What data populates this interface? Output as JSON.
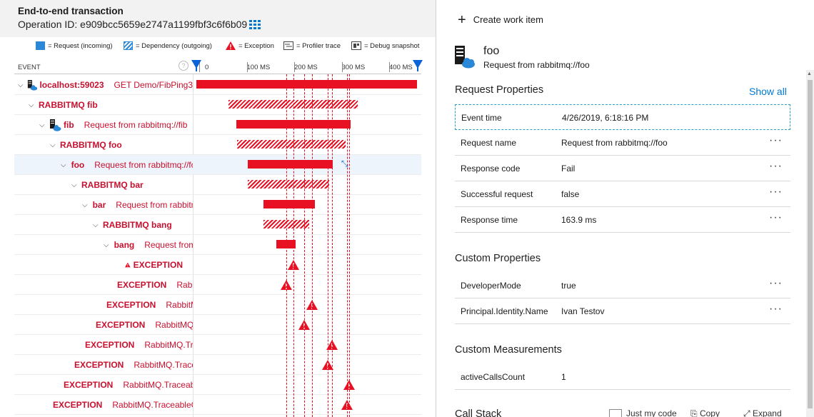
{
  "header": {
    "title": "End-to-end transaction",
    "operation": "Operation ID: e909bcc5659e2747a1199fbf3c6f6b09"
  },
  "legend": {
    "request": "= Request (incoming)",
    "dependency": "= Dependency (outgoing)",
    "exception": "= Exception",
    "profiler": "= Profiler trace",
    "debug": "= Debug snapshot"
  },
  "columns": {
    "event": "EVENT",
    "ticks": [
      "0",
      "100 MS",
      "200 MS",
      "300 MS",
      "400 MS"
    ]
  },
  "rows": [
    {
      "kind": "request",
      "indent": 0,
      "name": "localhost:59023",
      "desc": "GET Demo/FibPing3"
    },
    {
      "kind": "dependency",
      "indent": 1,
      "name": "RABBITMQ fib",
      "desc": ""
    },
    {
      "kind": "request",
      "indent": 2,
      "name": "fib",
      "desc": "Request from rabbitmq://fib"
    },
    {
      "kind": "dependency",
      "indent": 3,
      "name": "RABBITMQ foo",
      "desc": ""
    },
    {
      "kind": "request",
      "indent": 4,
      "name": "foo",
      "desc": "Request from rabbitmq://foo"
    },
    {
      "kind": "dependency",
      "indent": 5,
      "name": "RABBITMQ bar",
      "desc": ""
    },
    {
      "kind": "request",
      "indent": 6,
      "name": "bar",
      "desc": "Request from rabbitmq://bar"
    },
    {
      "kind": "dependency",
      "indent": 7,
      "name": "RABBITMQ bang",
      "desc": ""
    },
    {
      "kind": "request",
      "indent": 8,
      "name": "bang",
      "desc": "Request from rabbitmq://bang"
    },
    {
      "kind": "exception",
      "name": "EXCEPTION",
      "desc": ""
    },
    {
      "kind": "exception",
      "name": "EXCEPTION",
      "desc": "RabbitMQ.TraceableConsumer"
    },
    {
      "kind": "exception",
      "name": "EXCEPTION",
      "desc": "RabbitMQ.TraceableConsumer"
    },
    {
      "kind": "exception",
      "name": "EXCEPTION",
      "desc": "RabbitMQ.TraceableConsumer"
    },
    {
      "kind": "exception",
      "name": "EXCEPTION",
      "desc": "RabbitMQ.TraceableConsumer"
    },
    {
      "kind": "exception",
      "name": "EXCEPTION",
      "desc": "RabbitMQ.TraceableConsumer"
    },
    {
      "kind": "exception",
      "name": "EXCEPTION",
      "desc": "RabbitMQ.TraceableConsumer"
    },
    {
      "kind": "exception",
      "name": "EXCEPTION",
      "desc": "RabbitMQ.TraceableConsumer"
    }
  ],
  "timing": [
    {
      "start": 0,
      "end": 464
    },
    {
      "start": 68,
      "end": 340
    },
    {
      "start": 84,
      "end": 325
    },
    {
      "start": 86,
      "end": 315
    },
    {
      "start": 109,
      "end": 287
    },
    {
      "start": 109,
      "end": 280
    },
    {
      "start": 142,
      "end": 250
    },
    {
      "start": 142,
      "end": 238
    },
    {
      "start": 168,
      "end": 209
    },
    {
      "at": 205
    },
    {
      "at": 190
    },
    {
      "at": 244
    },
    {
      "at": 227
    },
    {
      "at": 286
    },
    {
      "at": 276
    },
    {
      "at": 322
    },
    {
      "at": 318
    }
  ],
  "selected_row": 4,
  "panel": {
    "create_work_item": "Create work item",
    "title": "foo",
    "subtitle": "Request from rabbitmq://foo",
    "request_properties": "Request Properties",
    "show_all": "Show all",
    "props": [
      {
        "key": "Event time",
        "value": "4/26/2019, 6:18:16 PM"
      },
      {
        "key": "Request name",
        "value": "Request from rabbitmq://foo"
      },
      {
        "key": "Response code",
        "value": "Fail"
      },
      {
        "key": "Successful request",
        "value": "false"
      },
      {
        "key": "Response time",
        "value": "163.9 ms"
      }
    ],
    "custom_properties": "Custom Properties",
    "custom": [
      {
        "key": "DeveloperMode",
        "value": "true"
      },
      {
        "key": "Principal.Identity.Name",
        "value": "Ivan Testov"
      }
    ],
    "custom_measurements": "Custom Measurements",
    "measurements": [
      {
        "key": "activeCallsCount",
        "value": "1"
      }
    ],
    "call_stack": "Call Stack",
    "just_my_code": "Just my code",
    "copy": "Copy",
    "expand": "Expand"
  },
  "colors": {
    "accent": "#e81123",
    "link": "#0078d4",
    "timeline_marker": "#0a64d8"
  },
  "icons": {
    "collapse": "double-chevron-right-icon",
    "grid": "grid-icon",
    "server": "server-cloud-icon",
    "warning": "warning-triangle-icon"
  }
}
